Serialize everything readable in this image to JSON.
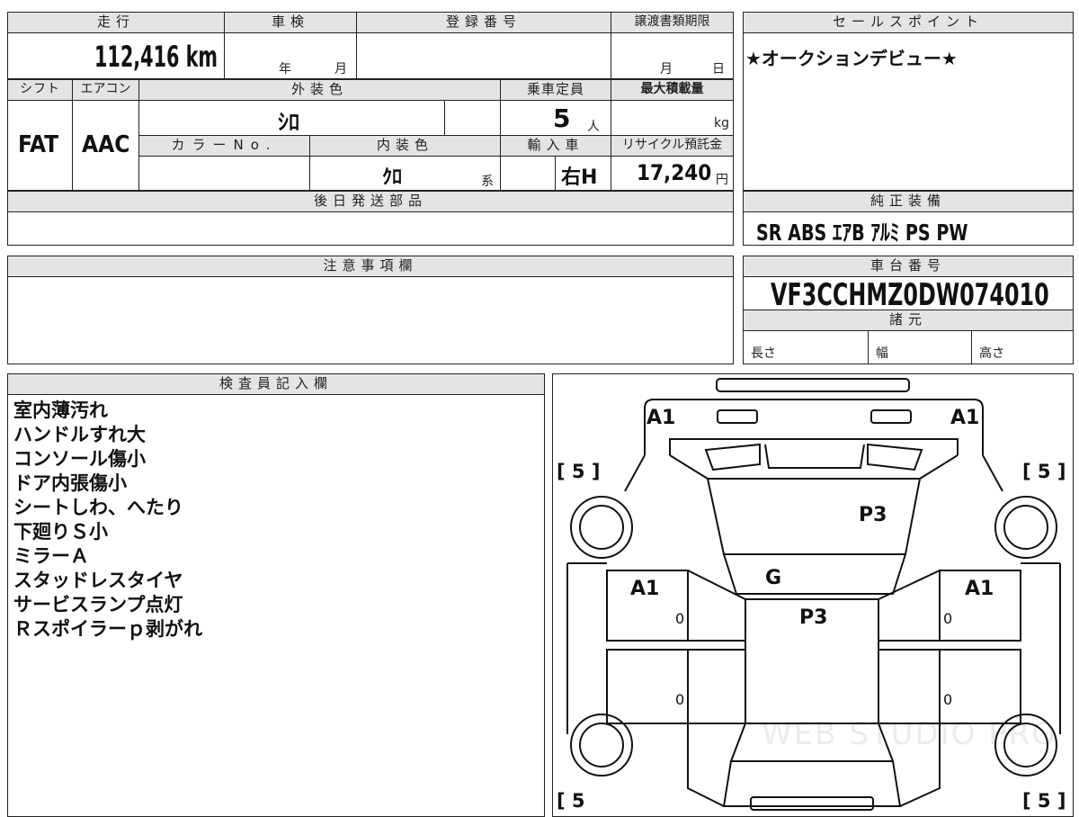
{
  "left": {
    "mileage_header": "走行",
    "mileage": "112,416 km",
    "inspection_header": "車検",
    "inspection_year": "年",
    "inspection_month": "月",
    "registration_header": "登録番号",
    "deadline_header": "譲渡書類期限",
    "deadline_month": "月",
    "deadline_day": "日",
    "shift_header": "シフト",
    "shift": "FAT",
    "aircon_header": "エアコン",
    "aircon": "AAC",
    "exterior_header": "外装色",
    "exterior": "ｼﾛ",
    "capacity_header": "乗車定員",
    "capacity": "5",
    "capacity_unit": "人",
    "maxload_header": "最大積載量",
    "maxload_unit": "kg",
    "colorno_header": "カラーNo.",
    "interior_header": "内装色",
    "interior": "ｸﾛ",
    "interior_suffix": "系",
    "import_header": "輸入車",
    "import": "右H",
    "recycle_header": "リサイクル預託金",
    "recycle": "17,240",
    "recycle_unit": "円",
    "later_parts_header": "後日発送部品",
    "notes_header": "注意事項欄",
    "inspector_header": "検査員記入欄",
    "inspector_remarks": [
      "室内薄汚れ",
      "ハンドルすれ大",
      "コンソール傷小",
      "ドア内張傷小",
      "シートしわ、へたり",
      "下廻りＳ小",
      "ミラーＡ",
      "スタッドレスタイヤ",
      "サービスランプ点灯",
      "Ｒスポイラーｐ剥がれ"
    ]
  },
  "right": {
    "sales_header": "セールスポイント",
    "sales_point": "★オークションデビュー★",
    "equipment_header": "純正装備",
    "equipment": "SR ABS ｴｱB ｱﾙﾐ PS PW",
    "chassis_header": "車台番号",
    "chassis_number": "VF3CCHMZ0DW074010",
    "specs_header": "諸元",
    "length_label": "長さ",
    "width_label": "幅",
    "height_label": "高さ"
  },
  "diagram": {
    "marks": {
      "front_left": "A1",
      "front_right": "A1",
      "hood": "P3",
      "windshield": "G",
      "roof": "P3",
      "left_door": "A1",
      "right_door": "A1",
      "left_door_front_zero": "0",
      "left_door_rear_zero": "0",
      "right_door_front_zero": "0",
      "right_door_rear_zero": "0"
    },
    "tire_fl": "[ 5 ]",
    "tire_fr": "[ 5 ]",
    "tire_rl": "[ 5",
    "tire_rr": "[ 5 ]",
    "watermark": "WEB STUDIO PRO"
  }
}
